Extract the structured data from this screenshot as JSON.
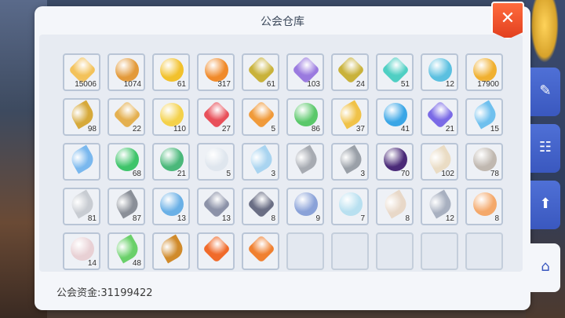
{
  "window": {
    "title": "公会仓库"
  },
  "funds": {
    "label": "公会资金:31199422"
  },
  "close": {
    "glyph": "✕"
  },
  "side_tabs": [
    {
      "name": "edit",
      "glyph": "✎"
    },
    {
      "name": "contacts",
      "glyph": "☷"
    },
    {
      "name": "upgrade",
      "glyph": "⬆"
    },
    {
      "name": "guild-home",
      "glyph": "⌂"
    }
  ],
  "rows": [
    [
      {
        "icon": "gold-crystal",
        "count": "15006",
        "color": "#f3c25a",
        "shape": "gem"
      },
      {
        "icon": "copper-coin",
        "count": "1074",
        "color": "#e39a3a",
        "shape": "round"
      },
      {
        "icon": "gold-coin",
        "count": "61",
        "color": "#f2c12c",
        "shape": "round"
      },
      {
        "icon": "orange-orb",
        "count": "317",
        "color": "#f08a2a",
        "shape": "round"
      },
      {
        "icon": "square-hole-coin",
        "count": "61",
        "color": "#c9b23a",
        "shape": "gem"
      },
      {
        "icon": "purple-crystal",
        "count": "103",
        "color": "#9a7adf",
        "shape": "gem"
      },
      {
        "icon": "square-hole-coin-2",
        "count": "24",
        "color": "#c9b23a",
        "shape": "gem"
      },
      {
        "icon": "teal-crystal",
        "count": "51",
        "color": "#4fcfc3",
        "shape": "gem"
      },
      {
        "icon": "blue-token",
        "count": "12",
        "color": "#5bc0e0",
        "shape": "round"
      },
      {
        "icon": "gift-coin",
        "count": "17900",
        "color": "#f0b030",
        "shape": "round"
      }
    ],
    [
      {
        "icon": "lightning-shard",
        "count": "98",
        "color": "#d6a93a",
        "shape": "feather"
      },
      {
        "icon": "gold-cross",
        "count": "22",
        "color": "#e4b050",
        "shape": "gem"
      },
      {
        "icon": "lemon-slice",
        "count": "110",
        "color": "#f4d14a",
        "shape": "round"
      },
      {
        "icon": "red-crystal",
        "count": "27",
        "color": "#e8505a",
        "shape": "gem"
      },
      {
        "icon": "flame-crystal",
        "count": "5",
        "color": "#f09a3a",
        "shape": "gem"
      },
      {
        "icon": "green-shield",
        "count": "86",
        "color": "#5ac86a",
        "shape": "round"
      },
      {
        "icon": "gold-spark",
        "count": "37",
        "color": "#f0c248",
        "shape": "feather"
      },
      {
        "icon": "blue-star-orb",
        "count": "41",
        "color": "#3aa6e6",
        "shape": "round"
      },
      {
        "icon": "violet-crystal",
        "count": "21",
        "color": "#7a6ae6",
        "shape": "gem"
      },
      {
        "icon": "ice-shard",
        "count": "15",
        "color": "#6fc0ee",
        "shape": "feather"
      }
    ],
    [
      {
        "icon": "blue-feather",
        "count": "",
        "color": "#7ab8ee",
        "shape": "feather"
      },
      {
        "icon": "green-gem",
        "count": "68",
        "color": "#3ec46a",
        "shape": "round"
      },
      {
        "icon": "green-leaf-orb",
        "count": "21",
        "color": "#4ab87a",
        "shape": "round"
      },
      {
        "icon": "snowflake",
        "count": "5",
        "color": "#dfe6ee",
        "shape": "round"
      },
      {
        "icon": "icicle",
        "count": "3",
        "color": "#a9d4f0",
        "shape": "feather"
      },
      {
        "icon": "grey-hook",
        "count": "",
        "color": "#a7abb2",
        "shape": "feather"
      },
      {
        "icon": "grey-smoke",
        "count": "3",
        "color": "#9aa0a8",
        "shape": "feather"
      },
      {
        "icon": "dark-vortex",
        "count": "70",
        "color": "#4a2a78",
        "shape": "round"
      },
      {
        "icon": "cream-horn",
        "count": "102",
        "color": "#eadcc4",
        "shape": "feather"
      },
      {
        "icon": "paw-prints",
        "count": "78",
        "color": "#c0b8b0",
        "shape": "round"
      }
    ],
    [
      {
        "icon": "small-feather",
        "count": "81",
        "color": "#c8ccd2",
        "shape": "feather"
      },
      {
        "icon": "grey-fang",
        "count": "87",
        "color": "#8a8f98",
        "shape": "feather"
      },
      {
        "icon": "water-drop",
        "count": "13",
        "color": "#6ab0e6",
        "shape": "round"
      },
      {
        "icon": "steel-gauntlet",
        "count": "13",
        "color": "#8c92a8",
        "shape": "gem"
      },
      {
        "icon": "iron-bracer",
        "count": "8",
        "color": "#6a6e84",
        "shape": "gem"
      },
      {
        "icon": "blue-ring",
        "count": "9",
        "color": "#8aa2d8",
        "shape": "round"
      },
      {
        "icon": "potion-bottle",
        "count": "7",
        "color": "#b8e0f0",
        "shape": "round"
      },
      {
        "icon": "flask",
        "count": "8",
        "color": "#e8d8c8",
        "shape": "feather"
      },
      {
        "icon": "dry-branch",
        "count": "12",
        "color": "#a8b0c0",
        "shape": "feather"
      },
      {
        "icon": "peach-orb",
        "count": "8",
        "color": "#f4a86a",
        "shape": "round"
      }
    ],
    [
      {
        "icon": "pale-bead",
        "count": "14",
        "color": "#e8d0d4",
        "shape": "round"
      },
      {
        "icon": "green-note",
        "count": "48",
        "color": "#6ad06a",
        "shape": "feather"
      },
      {
        "icon": "golden-sword",
        "count": "",
        "color": "#d08a2a",
        "shape": "feather"
      },
      {
        "icon": "flame-card",
        "count": "",
        "color": "#f06a2a",
        "shape": "gem"
      },
      {
        "icon": "fire-crystal-card",
        "count": "",
        "color": "#f08030",
        "shape": "gem"
      },
      {
        "icon": "",
        "count": "",
        "color": "",
        "shape": "empty"
      },
      {
        "icon": "",
        "count": "",
        "color": "",
        "shape": "empty"
      },
      {
        "icon": "",
        "count": "",
        "color": "",
        "shape": "empty"
      },
      {
        "icon": "",
        "count": "",
        "color": "",
        "shape": "empty"
      },
      {
        "icon": "",
        "count": "",
        "color": "",
        "shape": "empty"
      }
    ]
  ]
}
